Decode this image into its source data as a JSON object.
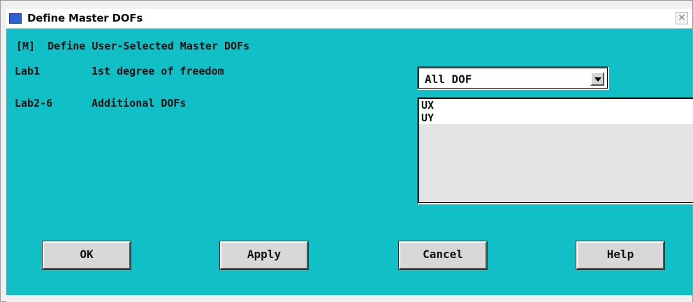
{
  "window": {
    "title": "Define Master DOFs",
    "close_glyph": "✕"
  },
  "dialog": {
    "header": "[M]  Define User-Selected Master DOFs",
    "lab1": {
      "key": "Lab1",
      "description": "1st degree of freedom",
      "selected_value": "All DOF"
    },
    "lab2_6": {
      "key": "Lab2-6",
      "description": "Additional DOFs",
      "items": [
        "UX",
        "UY"
      ]
    }
  },
  "buttons": {
    "ok": "OK",
    "apply": "Apply",
    "cancel": "Cancel",
    "help": "Help"
  },
  "colors": {
    "dialog_background": "#11c0c6",
    "title_icon": "#2f5fd6"
  }
}
